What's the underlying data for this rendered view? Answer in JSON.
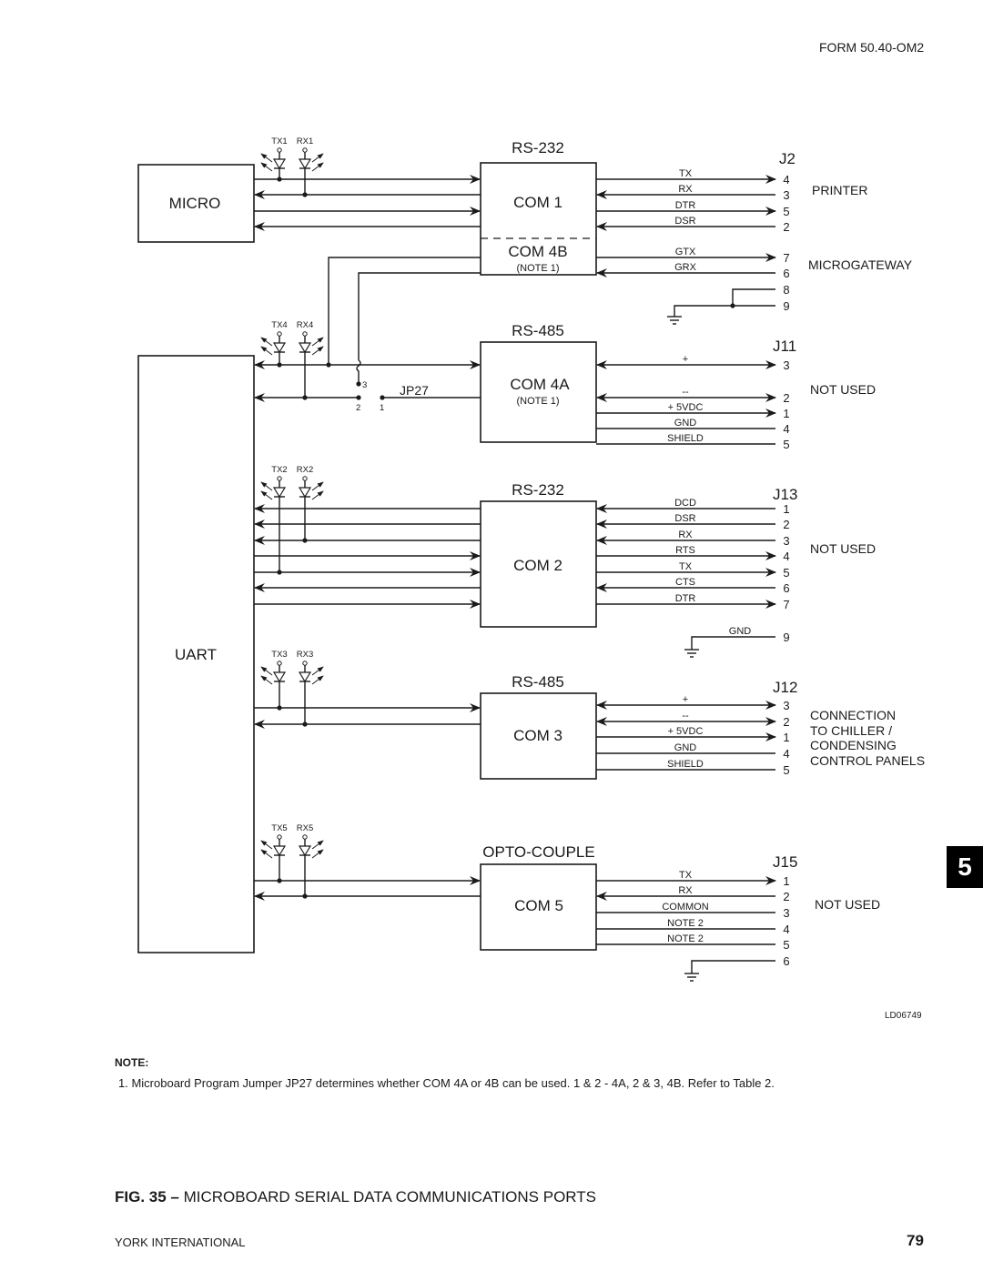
{
  "header": {
    "form_id": "FORM 50.40-OM2"
  },
  "section_tab": "5",
  "blocks": {
    "micro": "MICRO",
    "uart": "UART"
  },
  "leds": [
    {
      "tx": "TX1",
      "rx": "RX1"
    },
    {
      "tx": "TX4",
      "rx": "RX4"
    },
    {
      "tx": "TX2",
      "rx": "RX2"
    },
    {
      "tx": "TX3",
      "rx": "RX3"
    },
    {
      "tx": "TX5",
      "rx": "RX5"
    }
  ],
  "jumper": {
    "label": "JP27",
    "pins": [
      "3",
      "2",
      "1"
    ]
  },
  "ports": [
    {
      "standard": "RS-232",
      "name": "COM 1",
      "connector": "J2",
      "signals": [
        {
          "label": "TX",
          "pin": "4",
          "dir": "out"
        },
        {
          "label": "RX",
          "pin": "3",
          "dir": "in"
        },
        {
          "label": "DTR",
          "pin": "5",
          "dir": "out"
        },
        {
          "label": "DSR",
          "pin": "2",
          "dir": "in"
        }
      ],
      "destination": "PRINTER"
    },
    {
      "standard": "",
      "name": "COM 4B",
      "note": "(NOTE 1)",
      "connector": "J2",
      "signals": [
        {
          "label": "GTX",
          "pin": "7",
          "dir": "out"
        },
        {
          "label": "GRX",
          "pin": "6",
          "dir": "in"
        },
        {
          "label": "",
          "pin": "8",
          "dir": "none"
        },
        {
          "label": "",
          "pin": "9",
          "dir": "none"
        }
      ],
      "destination": "MICROGATEWAY"
    },
    {
      "standard": "RS-485",
      "name": "COM 4A",
      "note": "(NOTE 1)",
      "connector": "J11",
      "signals": [
        {
          "label": "+",
          "pin": "3",
          "dir": "both"
        },
        {
          "label": "--",
          "pin": "2",
          "dir": "both"
        },
        {
          "label": "+ 5VDC",
          "pin": "1",
          "dir": "out"
        },
        {
          "label": "GND",
          "pin": "4",
          "dir": "none"
        },
        {
          "label": "SHIELD",
          "pin": "5",
          "dir": "none"
        }
      ],
      "destination": "NOT USED"
    },
    {
      "standard": "RS-232",
      "name": "COM 2",
      "connector": "J13",
      "signals": [
        {
          "label": "DCD",
          "pin": "1",
          "dir": "in"
        },
        {
          "label": "DSR",
          "pin": "2",
          "dir": "in"
        },
        {
          "label": "RX",
          "pin": "3",
          "dir": "in"
        },
        {
          "label": "RTS",
          "pin": "4",
          "dir": "out"
        },
        {
          "label": "TX",
          "pin": "5",
          "dir": "out"
        },
        {
          "label": "CTS",
          "pin": "6",
          "dir": "in"
        },
        {
          "label": "DTR",
          "pin": "7",
          "dir": "out"
        },
        {
          "label": "GND",
          "pin": "9",
          "dir": "ground"
        }
      ],
      "destination": "NOT USED"
    },
    {
      "standard": "RS-485",
      "name": "COM 3",
      "connector": "J12",
      "signals": [
        {
          "label": "+",
          "pin": "3",
          "dir": "both"
        },
        {
          "label": "--",
          "pin": "2",
          "dir": "both"
        },
        {
          "label": "+ 5VDC",
          "pin": "1",
          "dir": "out"
        },
        {
          "label": "GND",
          "pin": "4",
          "dir": "none"
        },
        {
          "label": "SHIELD",
          "pin": "5",
          "dir": "none"
        }
      ],
      "destination_lines": [
        "CONNECTION",
        "TO CHILLER /",
        "CONDENSING",
        "CONTROL PANELS"
      ]
    },
    {
      "standard": "OPTO-COUPLE",
      "name": "COM 5",
      "connector": "J15",
      "signals": [
        {
          "label": "TX",
          "pin": "1",
          "dir": "out"
        },
        {
          "label": "RX",
          "pin": "2",
          "dir": "in"
        },
        {
          "label": "COMMON",
          "pin": "3",
          "dir": "none"
        },
        {
          "label": "NOTE 2",
          "pin": "4",
          "dir": "none"
        },
        {
          "label": "NOTE 2",
          "pin": "5",
          "dir": "none"
        },
        {
          "label": "",
          "pin": "6",
          "dir": "ground"
        }
      ],
      "destination": "NOT USED"
    }
  ],
  "drawing_id": "LD06749",
  "notes": {
    "heading": "NOTE:",
    "items": [
      "1.  Microboard Program Jumper JP27 determines whether COM 4A or 4B can be used. 1 & 2 - 4A, 2 & 3, 4B. Refer to Table 2."
    ]
  },
  "caption": {
    "prefix": "FIG. 35 –",
    "title": " MICROBOARD SERIAL DATA COMMUNICATIONS PORTS"
  },
  "footer": {
    "company": "YORK INTERNATIONAL",
    "page": "79"
  }
}
